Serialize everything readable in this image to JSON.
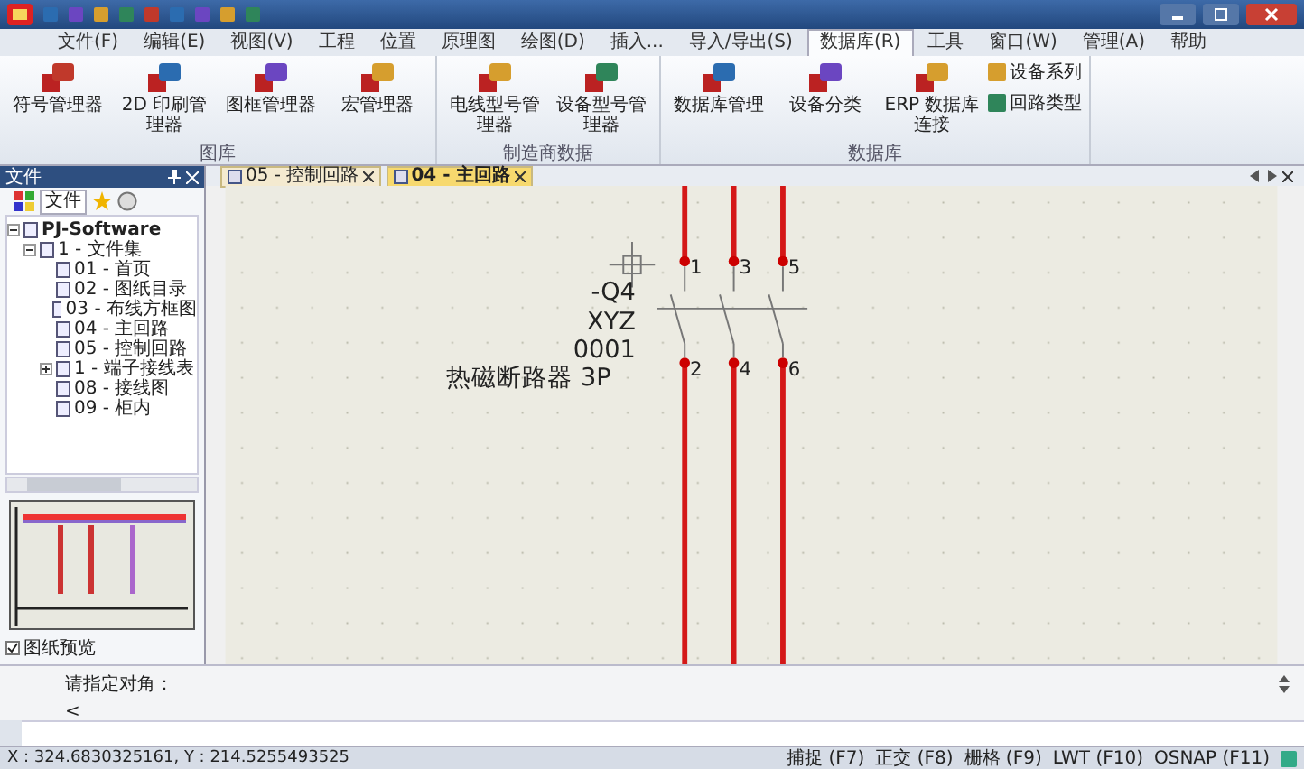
{
  "menu_tabs": [
    {
      "label": "文件(F)",
      "selected": false
    },
    {
      "label": "编辑(E)",
      "selected": false
    },
    {
      "label": "视图(V)",
      "selected": false
    },
    {
      "label": "工程",
      "selected": false
    },
    {
      "label": "位置",
      "selected": false
    },
    {
      "label": "原理图",
      "selected": false
    },
    {
      "label": "绘图(D)",
      "selected": false
    },
    {
      "label": "插入...",
      "selected": false
    },
    {
      "label": "导入/导出(S)",
      "selected": false
    },
    {
      "label": "数据库(R)",
      "selected": true
    },
    {
      "label": "工具",
      "selected": false
    },
    {
      "label": "窗口(W)",
      "selected": false
    },
    {
      "label": "管理(A)",
      "selected": false
    },
    {
      "label": "帮助",
      "selected": false
    }
  ],
  "ribbon": {
    "groups": [
      {
        "label": "图库",
        "buttons": [
          {
            "label": "符号管理器",
            "kind": "large"
          },
          {
            "label": "2D 印刷管理器",
            "kind": "large"
          },
          {
            "label": "图框管理器",
            "kind": "large"
          },
          {
            "label": "宏管理器",
            "kind": "large"
          }
        ]
      },
      {
        "label": "制造商数据",
        "buttons": [
          {
            "label": "电线型号管理器",
            "kind": "large"
          },
          {
            "label": "设备型号管理器",
            "kind": "large"
          }
        ]
      },
      {
        "label": "数据库",
        "buttons": [
          {
            "label": "数据库管理",
            "kind": "large"
          },
          {
            "label": "设备分类",
            "kind": "large"
          },
          {
            "label": "ERP 数据库连接",
            "kind": "large"
          },
          {
            "label": "设备系列",
            "kind": "small"
          },
          {
            "label": "回路类型",
            "kind": "small"
          }
        ]
      }
    ]
  },
  "side_panel": {
    "title": "文件",
    "tabs": [
      {
        "label": "文件",
        "selected": true
      }
    ],
    "tree": [
      {
        "label": "PJ-Software",
        "expanded": true,
        "children": [
          {
            "label": "1 - 文件集",
            "expanded": true,
            "children": [
              {
                "label": "01 - 首页"
              },
              {
                "label": "02 - 图纸目录"
              },
              {
                "label": "03 - 布线方框图"
              },
              {
                "label": "04 - 主回路"
              },
              {
                "label": "05 - 控制回路"
              },
              {
                "label": "1 - 端子接线表",
                "expanded": false
              },
              {
                "label": "08 - 接线图"
              },
              {
                "label": "09 - 柜内"
              }
            ]
          }
        ]
      }
    ],
    "preview_checkbox": {
      "label": "图纸预览",
      "checked": true
    }
  },
  "doc_tabs": [
    {
      "label": "05 - 控制回路",
      "selected": false
    },
    {
      "label": "04 - 主回路",
      "selected": true
    }
  ],
  "schematic": {
    "device_tag": "-Q4",
    "part_type": "XYZ",
    "part_number": "0001",
    "description": "热磁断路器 3P",
    "top_terminals": [
      "1",
      "3",
      "5"
    ],
    "bottom_terminals": [
      "2",
      "4",
      "6"
    ]
  },
  "command": {
    "prompt": "请指定对角：",
    "input": "<"
  },
  "status_bar": {
    "coordinates": "X : 324.6830325161, Y : 214.5255493525",
    "toggles": [
      "捕捉 (F7)",
      "正交 (F8)",
      "栅格 (F9)",
      "LWT (F10)",
      "OSNAP (F11)"
    ]
  }
}
